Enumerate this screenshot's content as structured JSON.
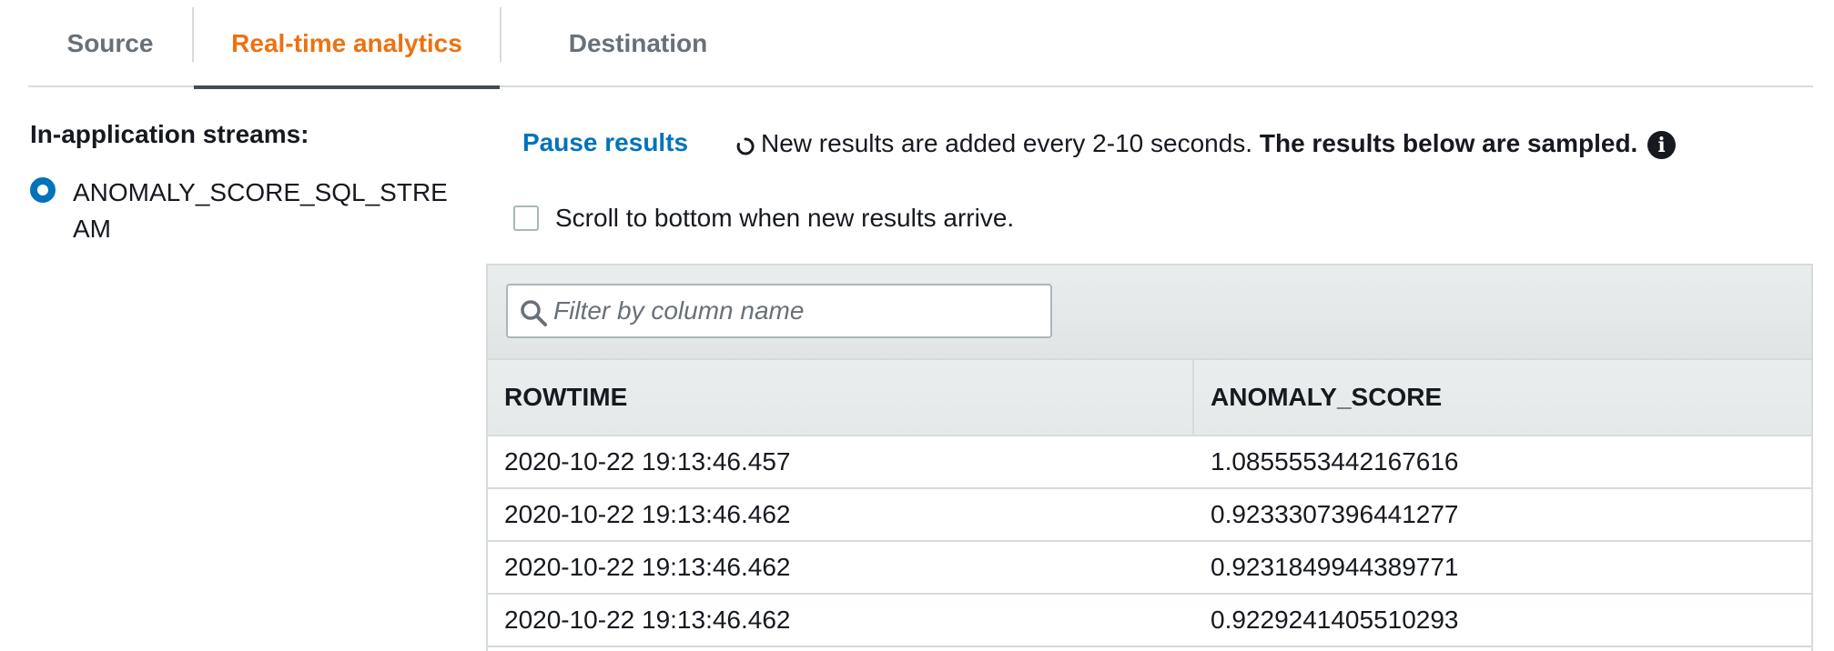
{
  "tabs": [
    {
      "label": "Source",
      "active": false
    },
    {
      "label": "Real-time analytics",
      "active": true
    },
    {
      "label": "Destination",
      "active": false
    }
  ],
  "streams": {
    "label": "In-application streams:",
    "selected": "ANOMALY_SCORE_SQL_STREAM"
  },
  "controls": {
    "pause_label": "Pause results",
    "info_prefix": "New results are added every 2-10 seconds.",
    "info_bold": "The results below are sampled.",
    "scroll_label": "Scroll to bottom when new results arrive.",
    "scroll_checked": false
  },
  "filter": {
    "placeholder": "Filter by column name",
    "value": ""
  },
  "table": {
    "columns": [
      "ROWTIME",
      "ANOMALY_SCORE"
    ],
    "rows": [
      [
        "2020-10-22 19:13:46.457",
        "1.0855553442167616"
      ],
      [
        "2020-10-22 19:13:46.462",
        "0.9233307396441277"
      ],
      [
        "2020-10-22 19:13:46.462",
        "0.9231849944389771"
      ],
      [
        "2020-10-22 19:13:46.462",
        "0.9229241405510293"
      ]
    ]
  },
  "colors": {
    "active_tab": "#ec7211",
    "link": "#0073bb",
    "radio": "#0073bb"
  }
}
